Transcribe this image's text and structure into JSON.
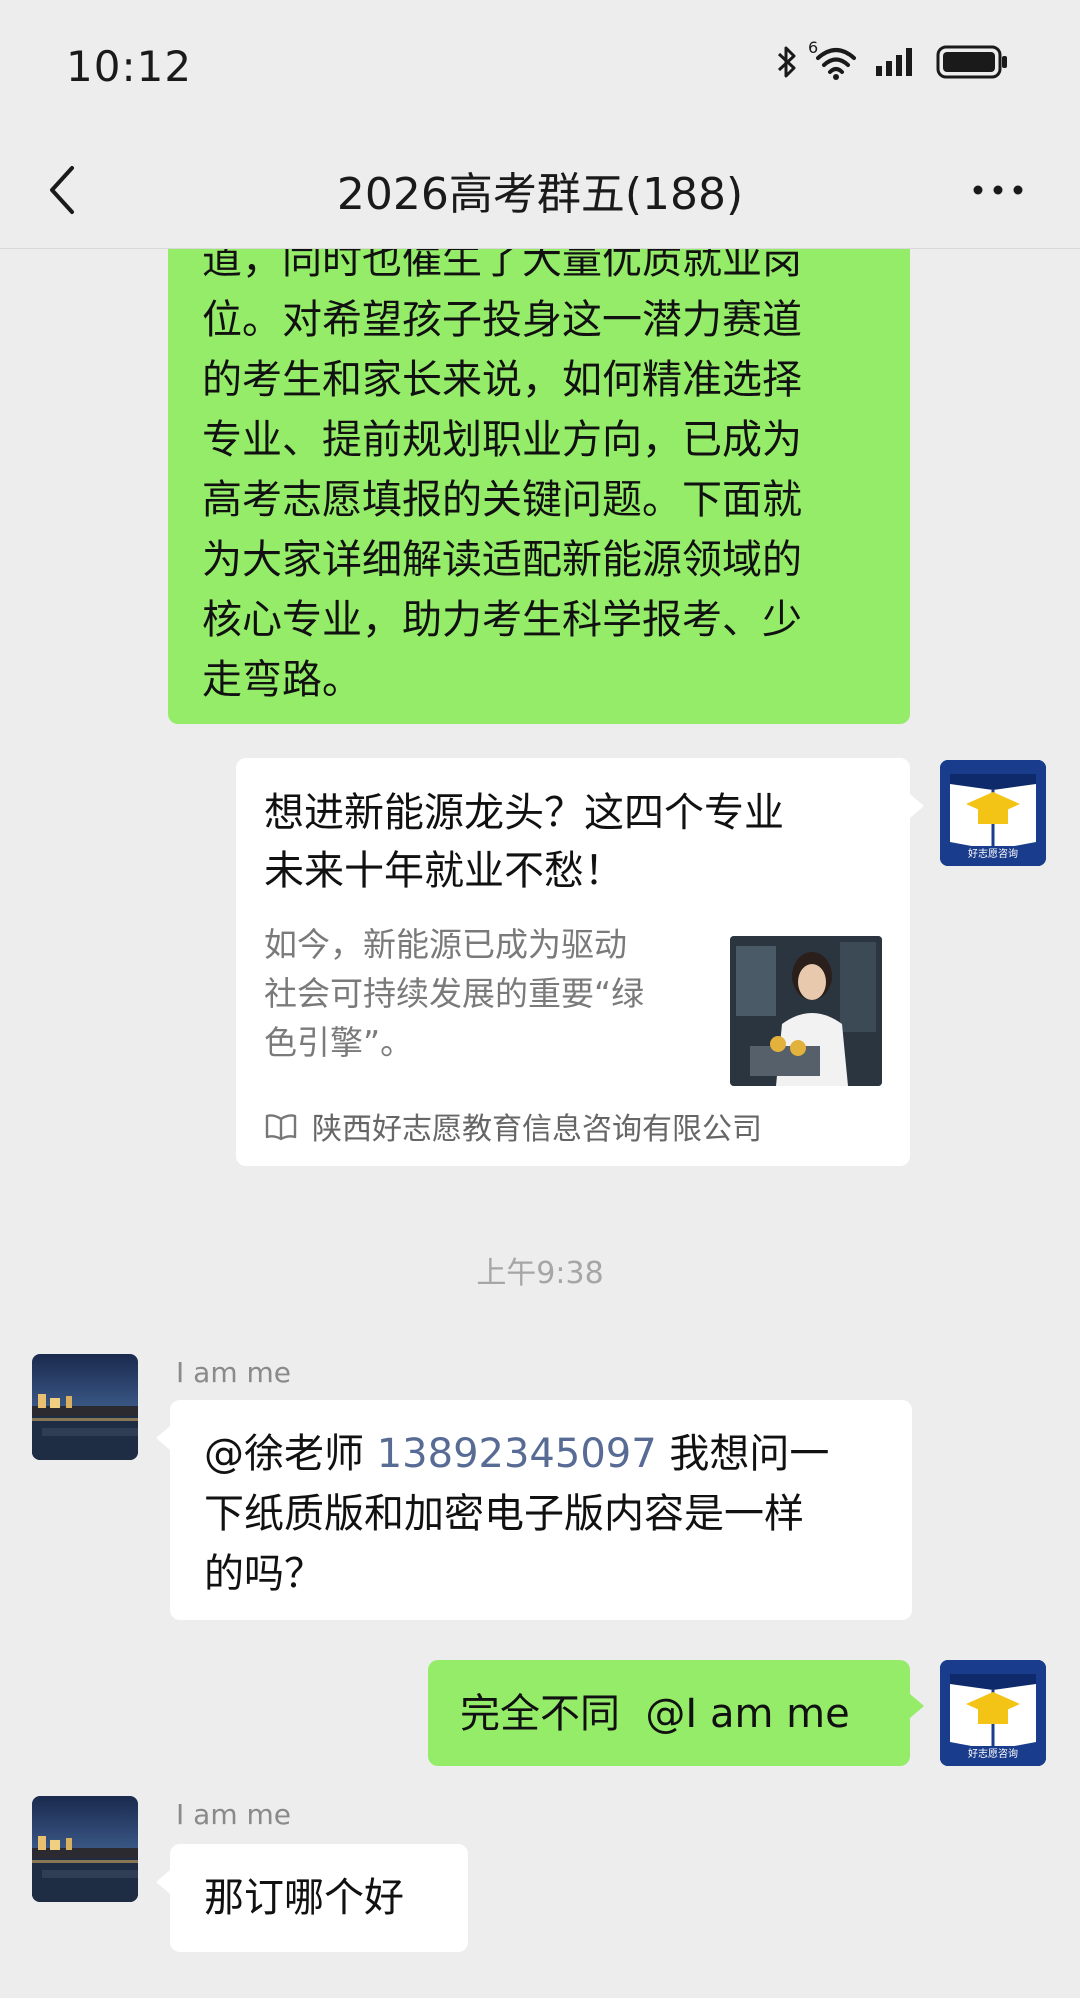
{
  "status_bar": {
    "time": "10:12",
    "icons": [
      "bluetooth-icon",
      "wifi-icon",
      "signal-icon",
      "battery-icon"
    ],
    "wifi_badge": "6"
  },
  "header": {
    "title": "2026高考群五(188)",
    "back_icon": "chevron-left-icon",
    "more_icon": "more-dots-icon"
  },
  "messages": {
    "long_text_lines": [
      "道，同时也催生了大量优质就业岗",
      "位。对希望孩子投身这一潜力赛道",
      "的考生和家长来说，如何精准选择",
      "专业、提前规划职业方向，已成为",
      "高考志愿填报的关键问题。下面就",
      "为大家详细解读适配新能源领域的",
      "核心专业，助力考生科学报考、少",
      "走弯路。"
    ],
    "article_card": {
      "title_lines": [
        "想进新能源龙头？这四个专业",
        "未来十年就业不愁！"
      ],
      "desc_lines": [
        "如今，新能源已成为驱动",
        "社会可持续发展的重要“绿",
        "色引擎”。"
      ],
      "source": "陕西好志愿教育信息咨询有限公司",
      "source_icon": "book-open-icon"
    },
    "timestamp": "上午9:38",
    "msg1": {
      "nickname": "I am me",
      "mention": "@徐老师",
      "phone": "13892345097",
      "line1_rest": " 我想问一",
      "line2": "下纸质版和加密电子版内容是一样",
      "line3": "的吗？"
    },
    "msg2": {
      "text": "完全不同  @I am me"
    },
    "msg3": {
      "nickname": "I am me",
      "text": "那订哪个好"
    },
    "self_avatar_label": "好志愿咨询"
  },
  "colors": {
    "bg": "#ededed",
    "green_bubble": "#95ec69",
    "link": "#576b95"
  }
}
